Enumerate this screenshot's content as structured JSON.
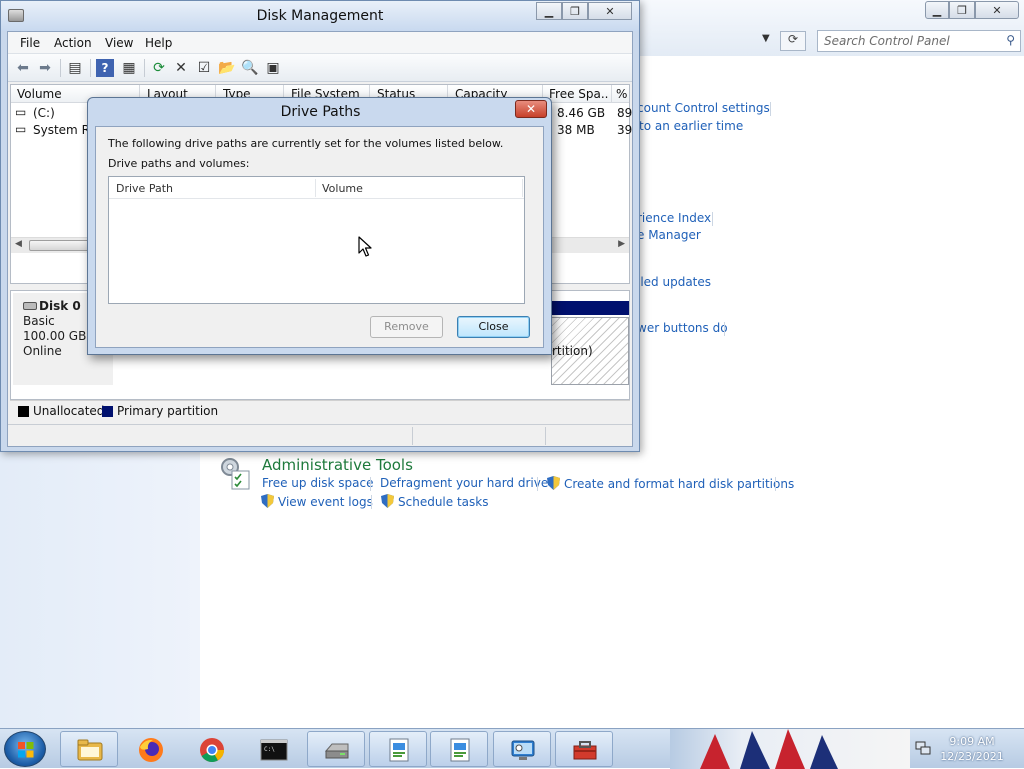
{
  "control_panel": {
    "search_placeholder": "Search Control Panel",
    "links": {
      "account_control": "count Control settings",
      "earlier_time": "to an earlier time",
      "experience_index": "rience Index",
      "manager": "e Manager",
      "installed_updates": "lled updates",
      "power_buttons": "wer buttons do"
    },
    "admin_tools": {
      "title": "Administrative Tools",
      "free_disk": "Free up disk space",
      "defragment": "Defragment your hard drive",
      "create_format": "Create and format hard disk partitions",
      "event_logs": "View event logs",
      "schedule_tasks": "Schedule tasks"
    }
  },
  "disk_management": {
    "title": "Disk Management",
    "menu": [
      "File",
      "Action",
      "View",
      "Help"
    ],
    "columns": [
      "Volume",
      "Layout",
      "Type",
      "File System",
      "Status",
      "Capacity",
      "Free Spa...",
      "% F"
    ],
    "rows": [
      {
        "volume": "(C:)",
        "free_space": "8.46 GB",
        "pct_free": "89"
      },
      {
        "volume": "System Res",
        "free_space": "38 MB",
        "pct_free": "39"
      }
    ],
    "disk": {
      "name": "Disk 0",
      "type": "Basic",
      "size": "100.00 GB",
      "status": "Online",
      "partition_label": "rtition)"
    },
    "legend": {
      "unallocated": "Unallocated",
      "primary": "Primary partition",
      "unallocated_color": "#000000",
      "primary_color": "#00106e"
    }
  },
  "dialog": {
    "title": "Drive Paths",
    "text1": "The following drive paths are currently set for the volumes listed below.",
    "text2": "Drive paths and volumes:",
    "col_drive_path": "Drive Path",
    "col_volume": "Volume",
    "remove_label": "Remove",
    "close_label": "Close",
    "close_x": "✕"
  },
  "taskbar": {
    "clock_time": "9:09 AM",
    "clock_date": "12/23/2021",
    "apps": [
      "file-explorer",
      "firefox",
      "chrome",
      "command-prompt",
      "disk-drive",
      "control-panel",
      "control-panel-2",
      "computer-management",
      "toolbox"
    ]
  }
}
